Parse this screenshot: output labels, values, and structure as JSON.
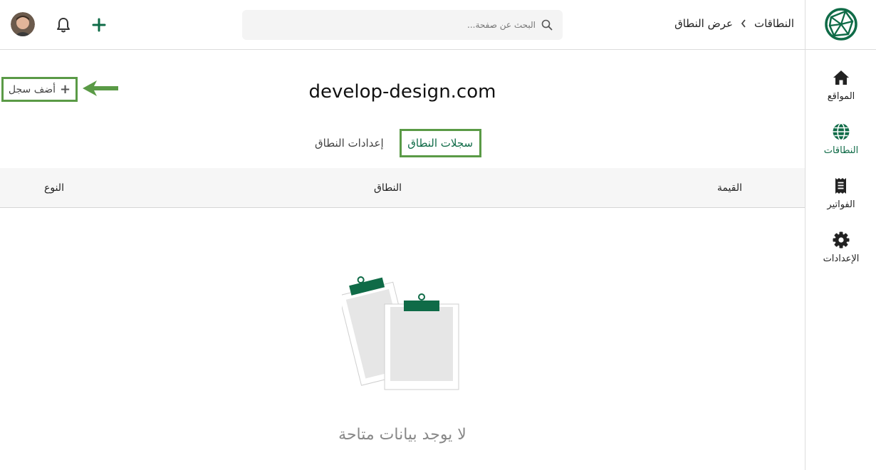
{
  "sidebar": {
    "items": [
      {
        "label": "المواقع",
        "icon": "home-icon"
      },
      {
        "label": "النطاقات",
        "icon": "globe-icon",
        "active": true
      },
      {
        "label": "الفواتير",
        "icon": "receipt-icon"
      },
      {
        "label": "الإعدادات",
        "icon": "gear-icon"
      }
    ]
  },
  "header": {
    "breadcrumb": [
      "النطاقات",
      "عرض النطاق"
    ],
    "search_placeholder": "البحث عن صفحة..."
  },
  "main": {
    "add_record_label": "أضف سجل",
    "domain_title": "develop-design.com",
    "tabs": [
      {
        "label": "سجلات النطاق",
        "active": true
      },
      {
        "label": "إعدادات النطاق"
      }
    ],
    "table": {
      "columns": [
        "القيمة",
        "النطاق",
        "النوع"
      ]
    },
    "empty_text": "لا يوجد بيانات متاحة"
  },
  "colors": {
    "brand": "#0f6b47",
    "highlight": "#5a9a46",
    "border": "#dcdcdc"
  }
}
